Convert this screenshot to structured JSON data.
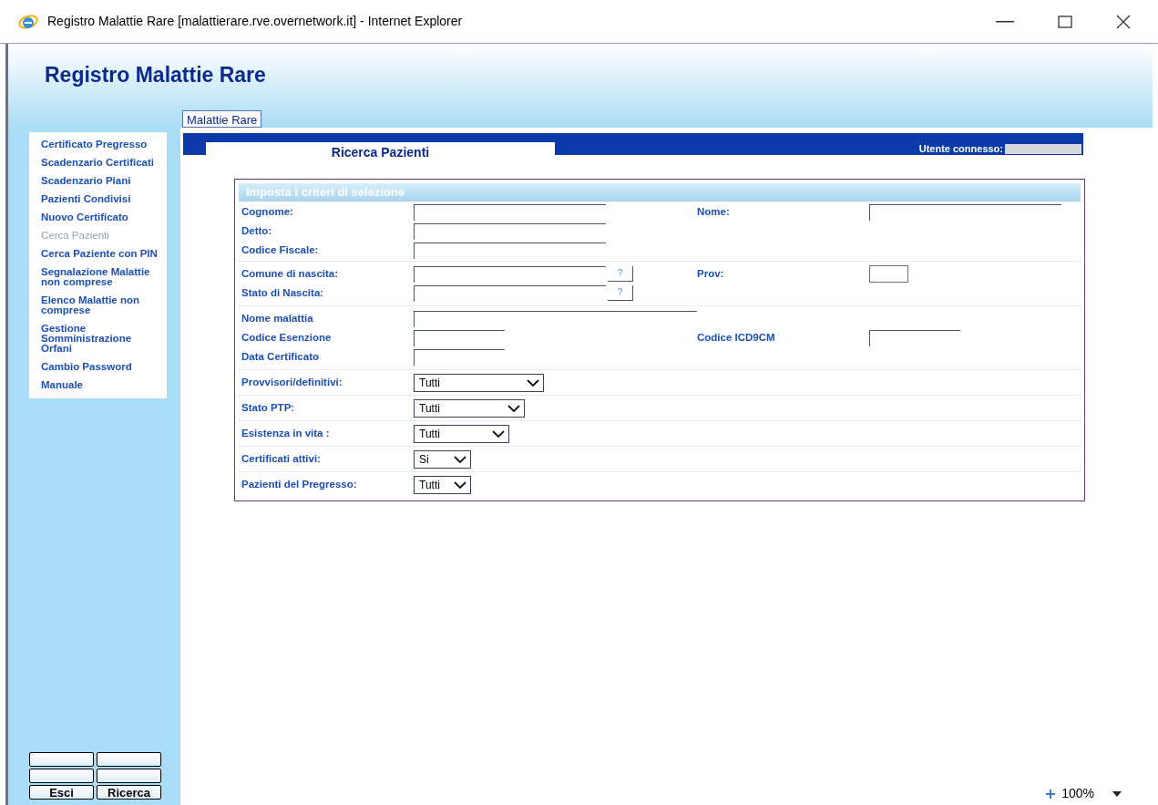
{
  "window": {
    "title": "Registro Malattie Rare [malattierare.rve.overnetwork.it] - Internet Explorer"
  },
  "header": {
    "title": "Registro Malattie Rare"
  },
  "top_tab": {
    "label": "Malattie Rare"
  },
  "sidebar": {
    "items": [
      {
        "label": "Certificato Pregresso",
        "disabled": false
      },
      {
        "label": "Scadenzario Certificati",
        "disabled": false
      },
      {
        "label": "Scadenzario Piani",
        "disabled": false
      },
      {
        "label": "Pazienti Condivisi",
        "disabled": false
      },
      {
        "label": "Nuovo Certificato",
        "disabled": false
      },
      {
        "label": "Cerca Pazienti",
        "disabled": true
      },
      {
        "label": "Cerca Paziente con PIN",
        "disabled": false
      },
      {
        "label": "Segnalazione Malattie non comprese",
        "disabled": false
      },
      {
        "label": "Elenco Malattie non comprese",
        "disabled": false
      },
      {
        "label": "Gestione Somministrazione Orfani",
        "disabled": false
      },
      {
        "label": "Cambio Password",
        "disabled": false
      },
      {
        "label": "Manuale",
        "disabled": false
      }
    ],
    "buttons": [
      "Esci",
      "Ricerca"
    ]
  },
  "page_tab": {
    "label": "Ricerca Pazienti"
  },
  "user": {
    "label": "Utente connesso:"
  },
  "form": {
    "title": "Imposta i criteri di selezione",
    "groups": [
      [
        [
          {
            "label": "Cognome:",
            "kind": "text"
          },
          {
            "label": "Nome:",
            "kind": "text"
          }
        ],
        [
          {
            "label": "Detto:",
            "kind": "text"
          }
        ],
        [
          {
            "label": "Codice Fiscale:",
            "kind": "text"
          }
        ]
      ],
      [
        [
          {
            "label": "Comune di nascita:",
            "kind": "lookup",
            "button": "?"
          },
          {
            "label": "Prov:",
            "kind": "tiny"
          }
        ],
        [
          {
            "label": "Stato di Nascita:",
            "kind": "lookup",
            "button": "?"
          }
        ]
      ],
      [
        [
          {
            "label": "Nome malattia",
            "kind": "long"
          }
        ],
        [
          {
            "label": "Codice Esenzione",
            "kind": "short"
          },
          {
            "label": "Codice ICD9CM",
            "kind": "short"
          }
        ],
        [
          {
            "label": "Data Certificato",
            "kind": "short"
          }
        ]
      ],
      [
        [
          {
            "label": "Provvisori/definitivi:",
            "kind": "select",
            "value": "Tutti"
          }
        ]
      ],
      [
        [
          {
            "label": "Stato PTP:",
            "kind": "select",
            "value": "Tutti"
          }
        ]
      ],
      [
        [
          {
            "label": "Esistenza in vita :",
            "kind": "select",
            "value": "Tutti"
          }
        ]
      ],
      [
        [
          {
            "label": "Certificati attivi:",
            "kind": "select",
            "value": "Si"
          }
        ]
      ],
      [
        [
          {
            "label": "Pazienti del Pregresso:",
            "kind": "select",
            "value": "Tutti"
          }
        ]
      ]
    ]
  },
  "status_bar": {
    "zoom": "100%"
  }
}
